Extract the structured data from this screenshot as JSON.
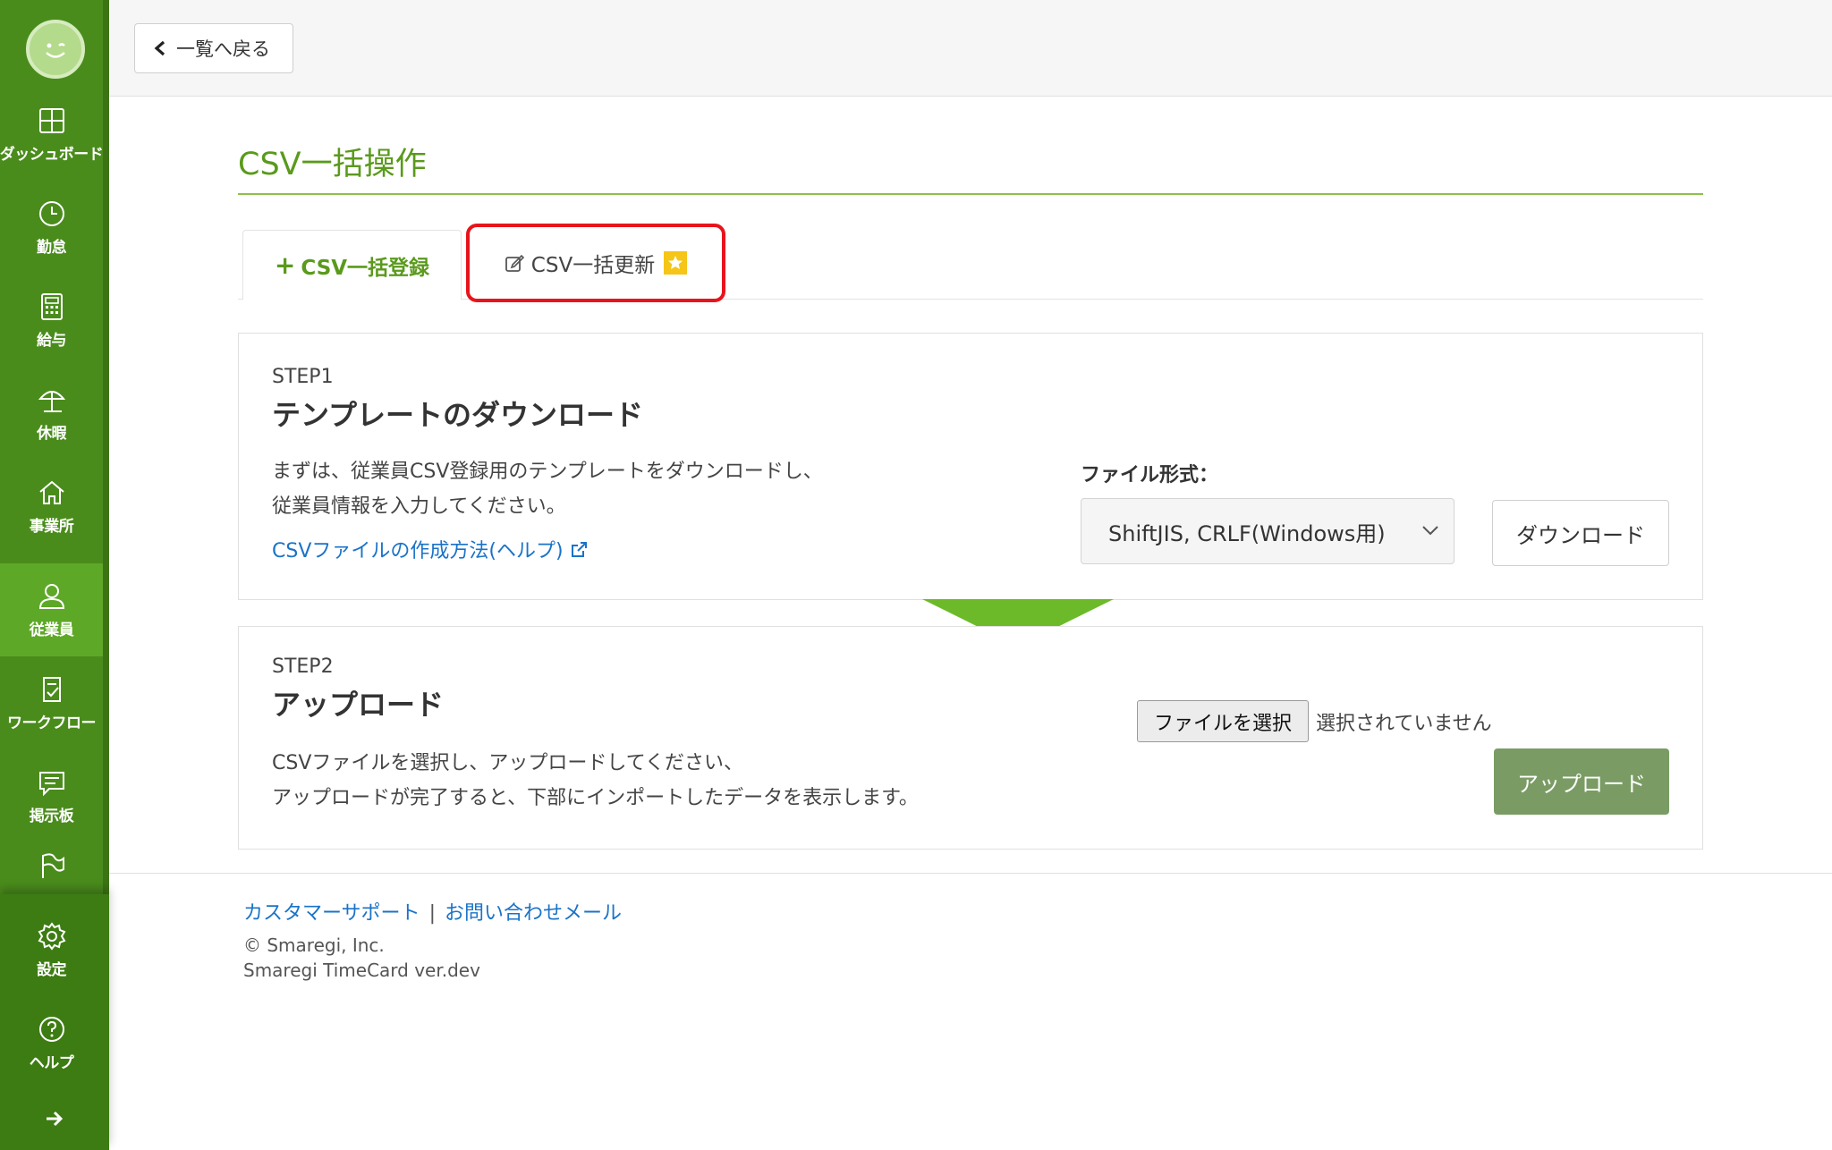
{
  "sidebar": {
    "items": [
      {
        "label": "ダッシュボード",
        "icon": "dashboard-icon"
      },
      {
        "label": "勤怠",
        "icon": "clock-icon"
      },
      {
        "label": "給与",
        "icon": "calculator-icon"
      },
      {
        "label": "休暇",
        "icon": "beach-umbrella-icon"
      },
      {
        "label": "事業所",
        "icon": "home-icon"
      },
      {
        "label": "従業員",
        "icon": "user-icon"
      },
      {
        "label": "ワークフロー",
        "icon": "clipboard-check-icon"
      },
      {
        "label": "掲示板",
        "icon": "message-icon"
      },
      {
        "label": "",
        "icon": "flag-icon"
      },
      {
        "label": "設定",
        "icon": "gear-icon"
      },
      {
        "label": "ヘルプ",
        "icon": "help-circle-icon"
      }
    ],
    "active_index": 5,
    "accent": "#4a8c1c"
  },
  "topbar": {
    "back_label": "一覧へ戻る"
  },
  "page": {
    "title": "CSV一括操作"
  },
  "tabs": {
    "register": "CSV一括登録",
    "update": "CSV一括更新"
  },
  "step1": {
    "label": "STEP1",
    "title": "テンプレートのダウンロード",
    "desc_line1": "まずは、従業員CSV登録用のテンプレートをダウンロードし、",
    "desc_line2": "従業員情報を入力してください。",
    "help_link": "CSVファイルの作成方法(ヘルプ)",
    "format_label": "ファイル形式：",
    "format_value": "ShiftJIS, CRLF(Windows用)",
    "download_label": "ダウンロード"
  },
  "step2": {
    "label": "STEP2",
    "title": "アップロード",
    "desc_line1": "CSVファイルを選択し、アップロードしてください、",
    "desc_line2": "アップロードが完了すると、下部にインポートしたデータを表示します。",
    "file_button": "ファイルを選択",
    "file_status": "選択されていません",
    "upload_label": "アップロード"
  },
  "footer": {
    "support_link": "カスタマーサポート",
    "separator": "|",
    "mail_link": "お問い合わせメール",
    "copyright": "© Smaregi, Inc.",
    "version": "Smaregi TimeCard ver.dev"
  }
}
